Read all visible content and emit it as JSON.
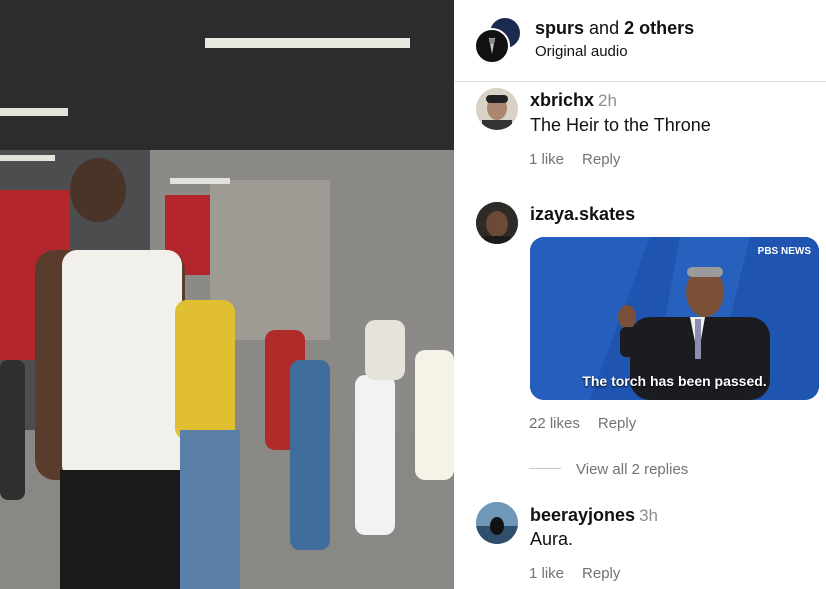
{
  "header": {
    "account": "spurs",
    "and_text": "and",
    "others": "2 others",
    "subtitle": "Original audio"
  },
  "comments": [
    {
      "username": "xbrichx",
      "time": "2h",
      "text": "The Heir to the Throne",
      "likes": "1 like",
      "reply": "Reply"
    },
    {
      "username": "izaya.skates",
      "gif_caption": "The torch has been passed.",
      "gif_logo": "PBS NEWS",
      "likes": "22 likes",
      "reply": "Reply",
      "view_replies": "View all 2 replies"
    },
    {
      "username": "beerayjones",
      "time": "3h",
      "text": "Aura.",
      "likes": "1 like",
      "reply": "Reply"
    }
  ],
  "colors": {
    "text": "#111111",
    "muted": "#737373",
    "divider": "#dbdbdb"
  }
}
